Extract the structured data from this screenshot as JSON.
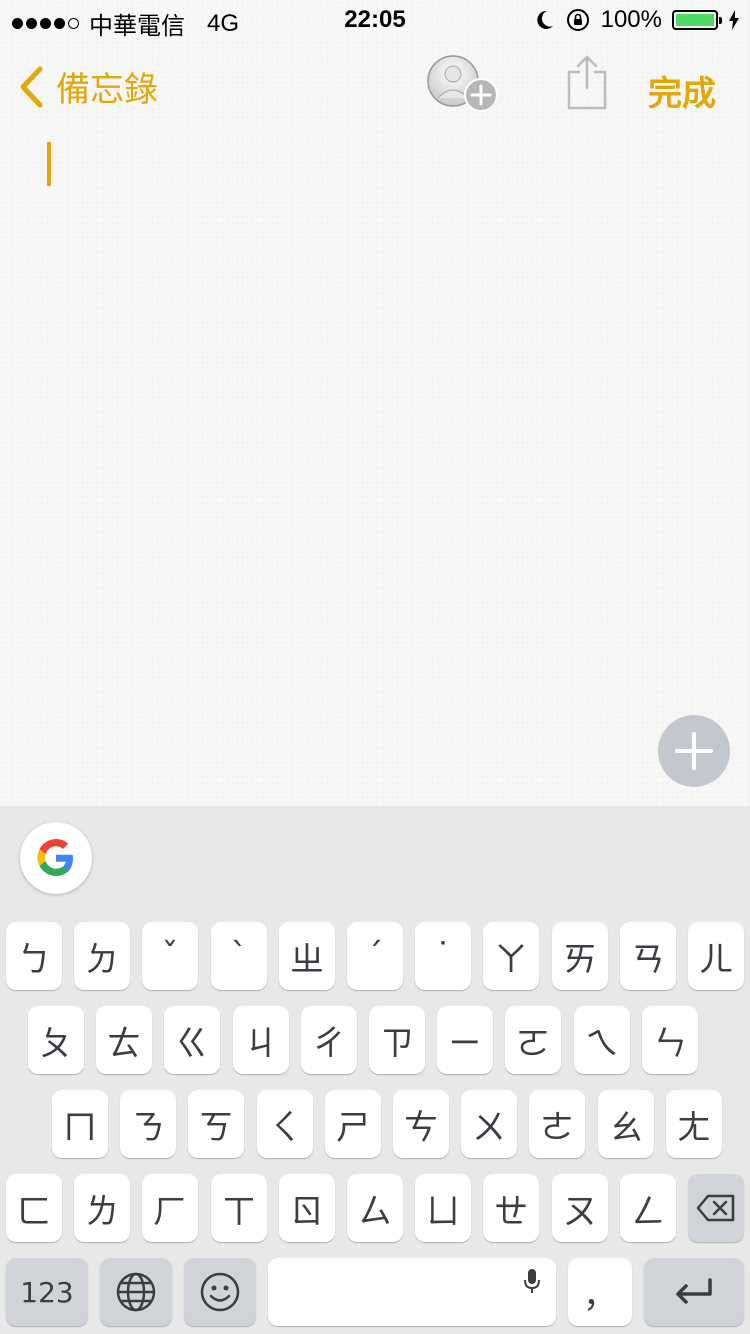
{
  "status_bar": {
    "carrier": "中華電信",
    "network": "4G",
    "time": "22:05",
    "battery_text": "100%",
    "battery_level": 1.0,
    "battery_color": "#4cd964",
    "signal_bars_filled": 4,
    "signal_bars_total": 5
  },
  "nav": {
    "back_label": "備忘錄",
    "done_label": "完成",
    "accent_color": "#e2a70b",
    "add_people_icon": "add-people-icon",
    "share_icon": "share-icon"
  },
  "note": {
    "body": ""
  },
  "keyboard": {
    "google_icon": "google-g-icon",
    "row1": [
      "ㄅ",
      "ㄉ",
      "ˇ",
      "ˋ",
      "ㄓ",
      "ˊ",
      "˙",
      "ㄚ",
      "ㄞ",
      "ㄢ",
      "ㄦ"
    ],
    "row2": [
      "ㄆ",
      "ㄊ",
      "ㄍ",
      "ㄐ",
      "ㄔ",
      "ㄗ",
      "ㄧ",
      "ㄛ",
      "ㄟ",
      "ㄣ"
    ],
    "row3": [
      "ㄇ",
      "ㄋ",
      "ㄎ",
      "ㄑ",
      "ㄕ",
      "ㄘ",
      "ㄨ",
      "ㄜ",
      "ㄠ",
      "ㄤ"
    ],
    "row4": [
      "ㄈ",
      "ㄌ",
      "ㄏ",
      "ㄒ",
      "ㄖ",
      "ㄙ",
      "ㄩ",
      "ㄝ",
      "ㄡ",
      "ㄥ"
    ],
    "numbers_label": "123",
    "comma_label": "，",
    "globe_icon": "globe-icon",
    "emoji_icon": "emoji-icon",
    "mic_icon": "microphone-icon",
    "delete_icon": "backspace-icon",
    "return_icon": "return-icon"
  }
}
